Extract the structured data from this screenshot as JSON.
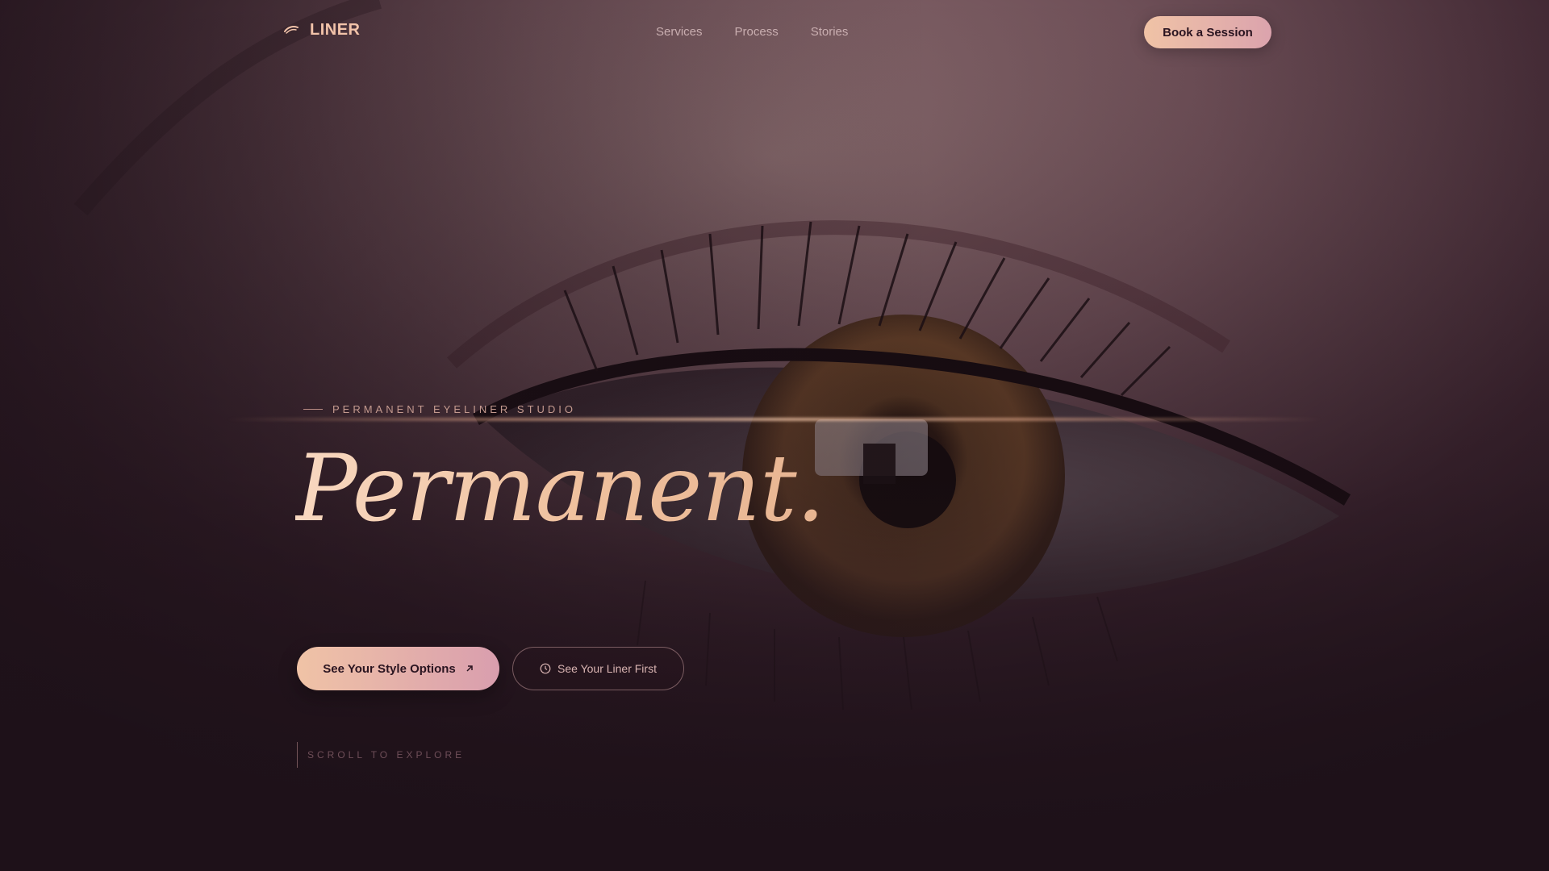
{
  "brand": {
    "name": "LINER",
    "icon": "eye-stroke-icon"
  },
  "nav": {
    "links": [
      "Services",
      "Process",
      "Stories"
    ],
    "cta_label": "Book a Session"
  },
  "hero": {
    "eyebrow": "PERMANENT EYELINER STUDIO",
    "headline": "Permanent.",
    "primary_button": {
      "label": "See Your Style Options",
      "icon": "arrow-up-right-icon"
    },
    "secondary_button": {
      "label": "See Your Liner First",
      "icon": "clock-icon"
    },
    "scroll_hint": "SCROLL TO EXPLORE",
    "background": "eye-closeup-image"
  },
  "colors": {
    "accent": "#f0c3a6",
    "accent_pink": "#d99eae",
    "background_dark": "#1e1119",
    "headline": "#efc09d"
  }
}
